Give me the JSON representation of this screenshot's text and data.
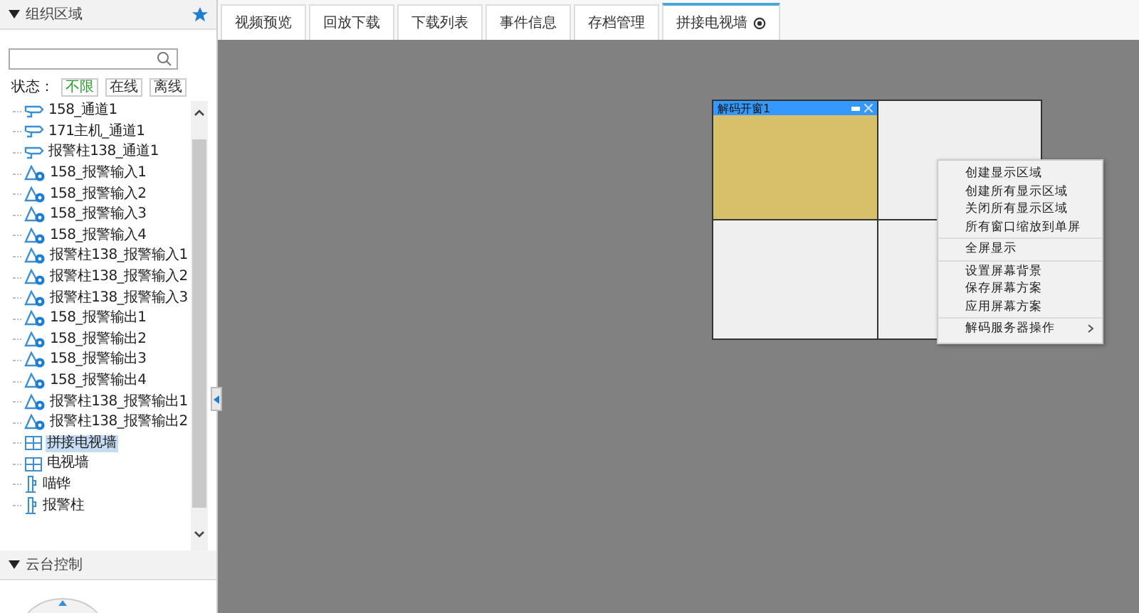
{
  "sidebar": {
    "org_header": {
      "title": "组织区域",
      "expanded": true
    },
    "status_filter": {
      "label": "状态：",
      "options": [
        {
          "label": "不限",
          "selected": true
        },
        {
          "label": "在线",
          "selected": false
        },
        {
          "label": "离线",
          "selected": false
        }
      ]
    },
    "tree": [
      {
        "kind": "camera",
        "label": "158_通道1",
        "selected": false
      },
      {
        "kind": "camera",
        "label": "171主机_通道1",
        "selected": false
      },
      {
        "kind": "camera",
        "label": "报警柱138_通道1",
        "selected": false
      },
      {
        "kind": "alarm",
        "label": "158_报警输入1",
        "selected": false
      },
      {
        "kind": "alarm",
        "label": "158_报警输入2",
        "selected": false
      },
      {
        "kind": "alarm",
        "label": "158_报警输入3",
        "selected": false
      },
      {
        "kind": "alarm",
        "label": "158_报警输入4",
        "selected": false
      },
      {
        "kind": "alarm",
        "label": "报警柱138_报警输入1",
        "selected": false
      },
      {
        "kind": "alarm",
        "label": "报警柱138_报警输入2",
        "selected": false
      },
      {
        "kind": "alarm",
        "label": "报警柱138_报警输入3",
        "selected": false
      },
      {
        "kind": "alarm",
        "label": "158_报警输出1",
        "selected": false
      },
      {
        "kind": "alarm",
        "label": "158_报警输出2",
        "selected": false
      },
      {
        "kind": "alarm",
        "label": "158_报警输出3",
        "selected": false
      },
      {
        "kind": "alarm",
        "label": "158_报警输出4",
        "selected": false
      },
      {
        "kind": "alarm",
        "label": "报警柱138_报警输出1",
        "selected": false
      },
      {
        "kind": "alarm",
        "label": "报警柱138_报警输出2",
        "selected": false
      },
      {
        "kind": "wall",
        "label": "拼接电视墙",
        "selected": true
      },
      {
        "kind": "wall",
        "label": "电视墙",
        "selected": false
      },
      {
        "kind": "pole",
        "label": "喵铧",
        "selected": false
      },
      {
        "kind": "pole",
        "label": "报警柱",
        "selected": false
      }
    ],
    "ptz_header": {
      "title": "云台控制",
      "expanded": true
    }
  },
  "tabs": [
    {
      "label": "视频预览",
      "selected": false
    },
    {
      "label": "回放下载",
      "selected": false
    },
    {
      "label": "下载列表",
      "selected": false
    },
    {
      "label": "事件信息",
      "selected": false
    },
    {
      "label": "存档管理",
      "selected": false
    },
    {
      "label": "拼接电视墙",
      "selected": true,
      "closable": true
    }
  ],
  "wall": {
    "windows": [
      {
        "title": "解码开窗1",
        "filled": true
      },
      {
        "filled": false
      },
      {
        "filled": false
      },
      {
        "filled": false
      }
    ]
  },
  "context_menu": {
    "groups": [
      [
        {
          "label": "创建显示区域"
        },
        {
          "label": "创建所有显示区域"
        },
        {
          "label": "关闭所有显示区域"
        },
        {
          "label": "所有窗口缩放到单屏"
        }
      ],
      [
        {
          "label": "全屏显示"
        }
      ],
      [
        {
          "label": "设置屏幕背景"
        },
        {
          "label": "保存屏幕方案"
        },
        {
          "label": "应用屏幕方案"
        }
      ],
      [
        {
          "label": "解码服务器操作",
          "submenu": true
        }
      ]
    ]
  }
}
